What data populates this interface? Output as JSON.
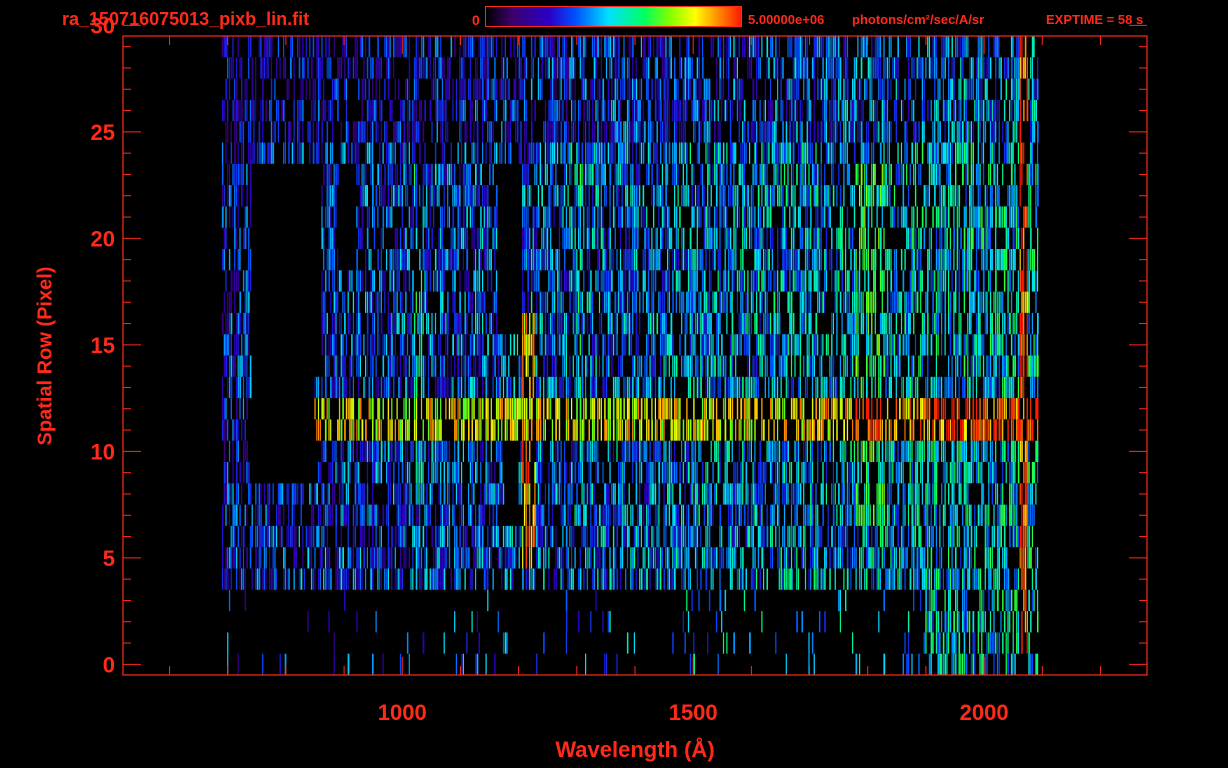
{
  "header": {
    "title": "ra_150716075013_pixb_lin.fit",
    "colorbar_min": "0",
    "colorbar_max": "5.00000e+06",
    "colorbar_units": "photons/cm²/sec/A/sr",
    "exptime": "EXPTIME = 58 s"
  },
  "colors": {
    "axis": "#ff2a1a",
    "background": "#000000",
    "colormap": [
      "#000000",
      "#3b006a",
      "#2a00c8",
      "#0050ff",
      "#00e0ff",
      "#00ff60",
      "#80ff00",
      "#ffff00",
      "#ff8000",
      "#ff1a00"
    ]
  },
  "chart_data": {
    "type": "heatmap",
    "title": "ra_150716075013_pixb_lin.fit",
    "xlabel": "Wavelength (Å)",
    "ylabel": "Spatial Row (Pixel)",
    "xlim": [
      520,
      2280
    ],
    "ylim": [
      -0.5,
      29.5
    ],
    "x_ticks": [
      1000,
      1500,
      2000
    ],
    "y_ticks": [
      0,
      5,
      10,
      15,
      20,
      25,
      30
    ],
    "grid": false,
    "colorbar": {
      "min": 0,
      "max": 5000000,
      "units": "photons/cm²/sec/A/sr",
      "position": "top"
    },
    "features": [
      {
        "name": "continuum band rows 11-12",
        "x": [
          840,
          2080
        ],
        "y": [
          11,
          12
        ],
        "intensity": 0.75
      },
      {
        "name": "bright line ~1216",
        "x": [
          1205,
          1230
        ],
        "y": [
          5,
          16
        ],
        "intensity": 0.85
      },
      {
        "name": "line ~1026",
        "x": [
          1020,
          1035
        ],
        "y": [
          8,
          23
        ],
        "intensity": 0.45
      },
      {
        "name": "line ~1304",
        "x": [
          1295,
          1310
        ],
        "y": [
          7,
          23
        ],
        "intensity": 0.45
      },
      {
        "name": "red edge ~2070",
        "x": [
          2060,
          2075
        ],
        "y": [
          0,
          30
        ],
        "intensity": 0.95
      }
    ]
  }
}
